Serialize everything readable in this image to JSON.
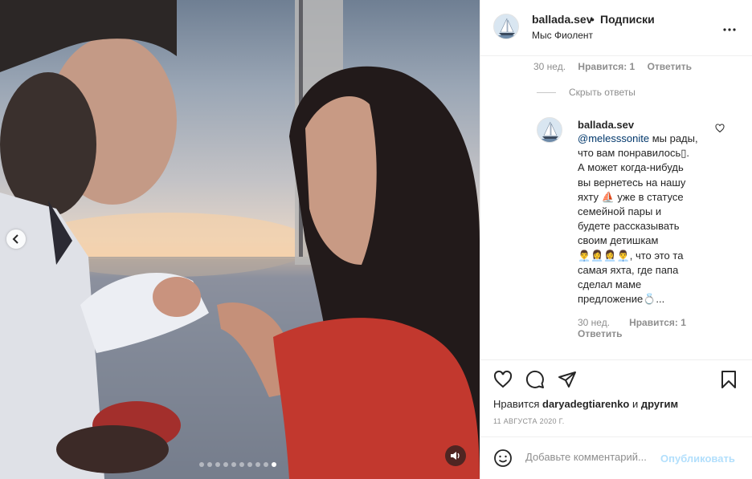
{
  "header": {
    "username": "ballada.sev",
    "separator": "•",
    "follow_label": "Подписки",
    "location": "Мыс Фиолент",
    "more_icon": "more-horizontal-icon"
  },
  "comment_meta": {
    "time": "30 нед.",
    "likes": "Нравится: 1",
    "reply": "Ответить"
  },
  "hide_replies": "Скрыть ответы",
  "reply": {
    "username": "ballada.sev",
    "mention": "@melesssonite",
    "lines": [
      "мы рады,",
      "что вам понравилось▯.",
      "А может когда-нибудь",
      "вы вернетесь на нашу",
      "яхту ⛵ уже в статусе",
      "семейной пары и",
      "будете рассказывать",
      "своим детишкам",
      "👨‍💼👩‍💼👩‍💼👨‍💼, что это та",
      "самая яхта, где папа",
      "сделал маме",
      "предложение💍..."
    ],
    "time": "30 нед.",
    "likes": "Нравится: 1",
    "reply": "Ответить"
  },
  "likes_line": {
    "prefix": "Нравится",
    "user": "daryadegtiarenko",
    "middle": "и",
    "others": "другим"
  },
  "date": "11 АВГУСТА 2020 Г.",
  "comment_input": {
    "placeholder": "Добавьте комментарий...",
    "publish": "Опубликовать"
  },
  "carousel": {
    "count": 10,
    "active": 10
  },
  "colors": {
    "link": "#00376b",
    "muted": "#8e8e8e",
    "text": "#262626",
    "publish_disabled": "#b2dffc"
  }
}
